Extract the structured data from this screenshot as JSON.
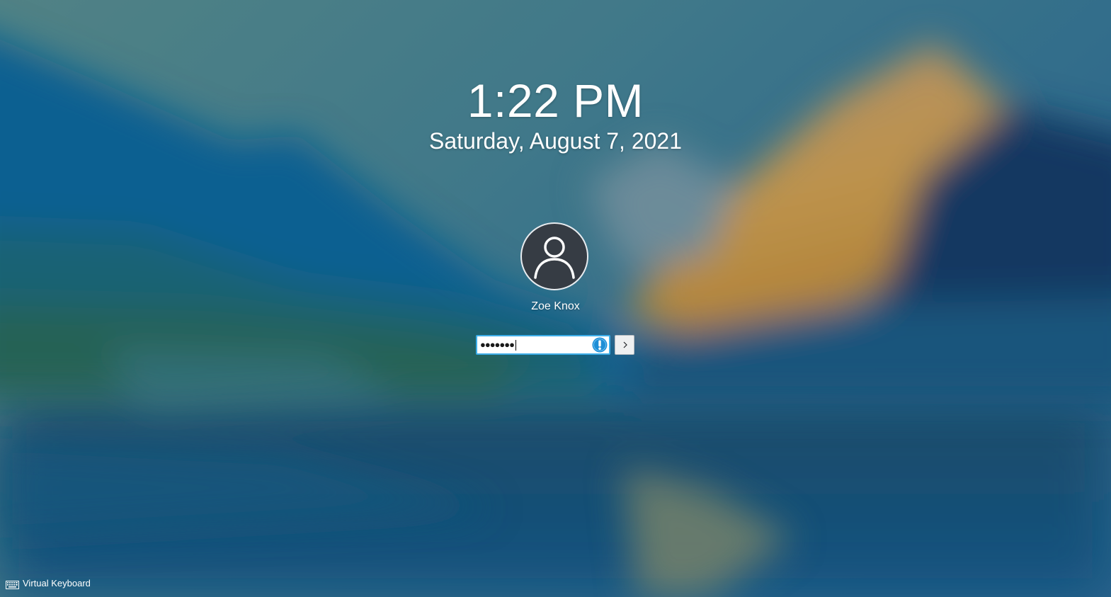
{
  "lockscreen": {
    "time": "1:22 PM",
    "date": "Saturday, August 7, 2021"
  },
  "user": {
    "name": "Zoe Knox",
    "avatar_icon": "user-icon"
  },
  "password": {
    "value": "●●●●●●●",
    "warning_icon": "caps-lock-warning-icon"
  },
  "submit": {
    "icon": "chevron-right-icon"
  },
  "footer": {
    "virtual_keyboard_label": "Virtual Keyboard",
    "icon": "keyboard-icon"
  },
  "colors": {
    "focus_border": "#3daee9",
    "warning_blue": "#1d8ed6",
    "avatar_bg": "#363c44"
  }
}
